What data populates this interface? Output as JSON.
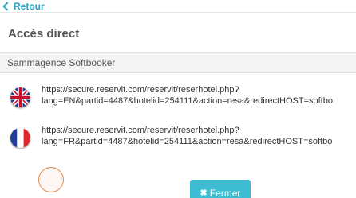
{
  "header": {
    "back_label": "Retour"
  },
  "modal": {
    "title": "Accès direct",
    "section_label": "Sammagence Softbooker",
    "links": [
      {
        "flag_icon": "uk-flag-icon",
        "line1": "https://secure.reservit.com/reservit/reserhotel.php?",
        "line2": "lang=EN&partid=4487&hotelid=254111&action=resa&redirectHOST=softbo"
      },
      {
        "flag_icon": "fr-flag-icon",
        "line1": "https://secure.reservit.com/reservit/reserhotel.php?",
        "line2": "lang=FR&partid=4487&hotelid=254111&action=resa&redirectHOST=softbo"
      }
    ],
    "close_label": "Fermer",
    "close_icon": "close-icon"
  },
  "colors": {
    "accent": "#29a3c7",
    "button": "#3dbcd2",
    "section_bg": "#f4f4f4"
  }
}
